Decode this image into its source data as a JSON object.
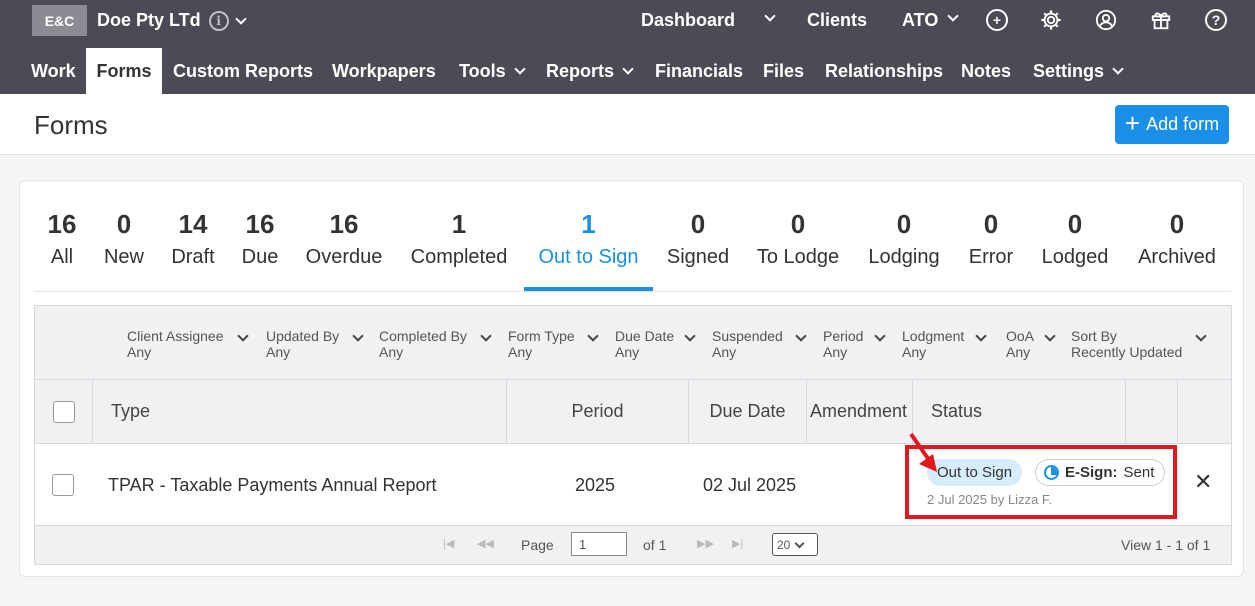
{
  "top": {
    "logo": "E&C",
    "org_name": "Doe Pty LTd",
    "links": {
      "dashboard": "Dashboard",
      "clients": "Clients",
      "ato": "ATO"
    }
  },
  "nav": {
    "work": "Work",
    "forms": "Forms",
    "custom_reports": "Custom Reports",
    "workpapers": "Workpapers",
    "tools": "Tools",
    "reports": "Reports",
    "financials": "Financials",
    "files": "Files",
    "relationships": "Relationships",
    "notes": "Notes",
    "settings": "Settings"
  },
  "header": {
    "title": "Forms",
    "add_label": "Add form"
  },
  "tabs": [
    {
      "count": "16",
      "label": "All"
    },
    {
      "count": "0",
      "label": "New"
    },
    {
      "count": "14",
      "label": "Draft"
    },
    {
      "count": "16",
      "label": "Due"
    },
    {
      "count": "16",
      "label": "Overdue"
    },
    {
      "count": "1",
      "label": "Completed"
    },
    {
      "count": "1",
      "label": "Out to Sign"
    },
    {
      "count": "0",
      "label": "Signed"
    },
    {
      "count": "0",
      "label": "To Lodge"
    },
    {
      "count": "0",
      "label": "Lodging"
    },
    {
      "count": "0",
      "label": "Error"
    },
    {
      "count": "0",
      "label": "Lodged"
    },
    {
      "count": "0",
      "label": "Archived"
    }
  ],
  "filters": [
    {
      "label": "Client Assignee",
      "value": "Any"
    },
    {
      "label": "Updated By",
      "value": "Any"
    },
    {
      "label": "Completed By",
      "value": "Any"
    },
    {
      "label": "Form Type",
      "value": "Any"
    },
    {
      "label": "Due Date",
      "value": "Any"
    },
    {
      "label": "Suspended",
      "value": "Any"
    },
    {
      "label": "Period",
      "value": "Any"
    },
    {
      "label": "Lodgment",
      "value": "Any"
    },
    {
      "label": "OoA",
      "value": "Any"
    },
    {
      "label": "Sort By",
      "value": "Recently Updated"
    }
  ],
  "columns": {
    "type": "Type",
    "period": "Period",
    "due_date": "Due Date",
    "amendment": "Amendment",
    "status": "Status"
  },
  "rows": [
    {
      "type": "TPAR - Taxable Payments Annual Report",
      "period": "2025",
      "due_date": "02 Jul 2025",
      "status": "Out to Sign",
      "esign_label": "E-Sign:",
      "esign_value": "Sent",
      "status_meta": "2 Jul 2025 by Lizza F."
    }
  ],
  "pager": {
    "page_label": "Page",
    "page_value": "1",
    "of_label": "of 1",
    "size": "20",
    "view": "View 1 - 1 of 1"
  },
  "colors": {
    "accent": "#1a8fe8",
    "topbar": "#4a4b55",
    "highlight": "#e0181f"
  }
}
